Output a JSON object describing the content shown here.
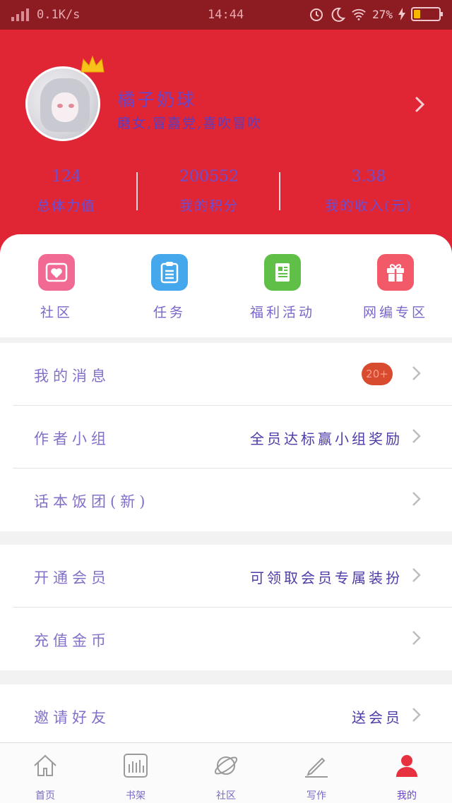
{
  "status_bar": {
    "net_speed": "0.1K/s",
    "time": "14:44",
    "battery_percent": "27%",
    "battery_level": 0.27
  },
  "profile": {
    "nickname": "橘子奶球",
    "signature": "磨女,冒嘉党,喜吹冒吹",
    "stats": [
      {
        "value": "124",
        "label": "总体力值"
      },
      {
        "value": "200552",
        "label": "我的积分"
      },
      {
        "value": "3.38",
        "label": "我的收入(元)"
      }
    ]
  },
  "quick_actions": [
    {
      "label": "社区",
      "icon": "heart-icon",
      "color": "#f06a93"
    },
    {
      "label": "任务",
      "icon": "clipboard-icon",
      "color": "#45a7ec"
    },
    {
      "label": "福利活动",
      "icon": "newspaper-icon",
      "color": "#5fbf47"
    },
    {
      "label": "网编专区",
      "icon": "gift-icon",
      "color": "#f25a6a"
    }
  ],
  "menu": {
    "group1": [
      {
        "title": "我的消息",
        "badge": "20+"
      },
      {
        "title": "作者小组",
        "value": "全员达标赢小组奖励"
      },
      {
        "title": "话本饭团(新)"
      }
    ],
    "group2": [
      {
        "title": "开通会员",
        "value": "可领取会员专属装扮"
      },
      {
        "title": "充值金币"
      }
    ],
    "group3": [
      {
        "title": "邀请好友",
        "value": "送会员"
      }
    ]
  },
  "tabbar": [
    {
      "label": "首页",
      "icon": "home-icon"
    },
    {
      "label": "书架",
      "icon": "bookshelf-icon"
    },
    {
      "label": "社区",
      "icon": "planet-icon"
    },
    {
      "label": "写作",
      "icon": "pen-icon"
    },
    {
      "label": "我的",
      "icon": "user-icon",
      "active": true
    }
  ],
  "colors": {
    "header_red": "#e02535",
    "status_bar_dark_red": "#8c1b22",
    "accent_purple": "#6a46c8",
    "badge_orange": "#d84b2e",
    "active_tab_red": "#e8313f"
  }
}
